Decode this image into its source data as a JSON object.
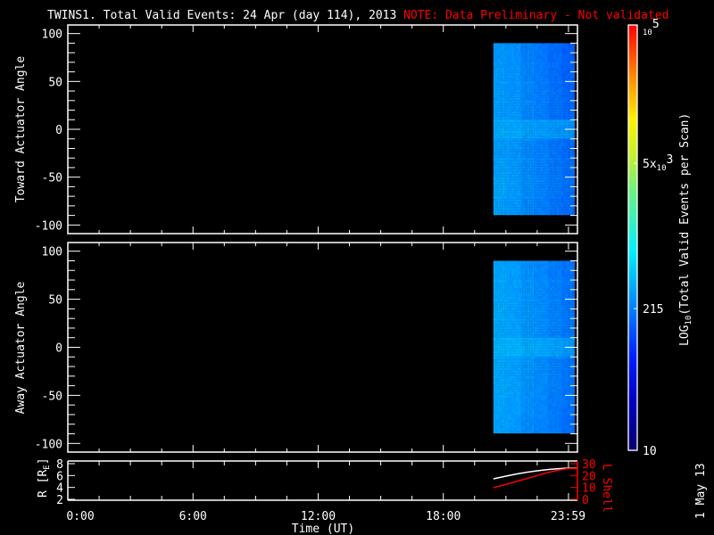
{
  "title": "TWINS1. Total Valid Events: 24 Apr (day 114), 2013",
  "note": "NOTE: Data Preliminary - Not validated",
  "date_stamp": "1 May 13",
  "colors": {
    "background": "#000000",
    "axes": "#ffffff",
    "note": "#ff0000",
    "r_line": "#ffffff",
    "l_line": "#ff0000"
  },
  "chart_data": [
    {
      "type": "heatmap",
      "name": "toward",
      "ylabel": "Toward Actuator Angle",
      "ylim": [
        -109,
        109
      ],
      "yticks": [
        "100",
        "50",
        "0",
        "-50",
        "-100"
      ],
      "ytick_values": [
        100,
        50,
        0,
        -50,
        -100
      ],
      "xlim_hours": [
        0,
        24.43
      ],
      "time_bins_hours": [
        20.4,
        21.05,
        21.7,
        22.35,
        23.0,
        23.65,
        24.25
      ],
      "angle_bins": [
        90,
        70,
        50,
        30,
        10,
        -10,
        -30,
        -50,
        -70,
        -89
      ],
      "values": [
        [
          290,
          260,
          230,
          200,
          180,
          160
        ],
        [
          300,
          270,
          240,
          210,
          185,
          165
        ],
        [
          300,
          275,
          245,
          215,
          190,
          170
        ],
        [
          305,
          280,
          250,
          220,
          195,
          175
        ],
        [
          360,
          340,
          320,
          300,
          290,
          280
        ],
        [
          310,
          285,
          255,
          225,
          200,
          180
        ],
        [
          320,
          290,
          260,
          230,
          205,
          185
        ],
        [
          340,
          300,
          265,
          235,
          210,
          190
        ],
        [
          310,
          285,
          255,
          225,
          200,
          180
        ]
      ]
    },
    {
      "type": "heatmap",
      "name": "away",
      "ylabel": "Away Actuator Angle",
      "ylim": [
        -109,
        109
      ],
      "yticks": [
        "100",
        "50",
        "0",
        "-50",
        "-100"
      ],
      "ytick_values": [
        100,
        50,
        0,
        -50,
        -100
      ],
      "xlim_hours": [
        0,
        24.43
      ],
      "time_bins_hours": [
        20.4,
        21.05,
        21.7,
        22.35,
        23.0,
        23.65,
        24.25
      ],
      "angle_bins": [
        90,
        70,
        50,
        30,
        10,
        -10,
        -30,
        -50,
        -70,
        -89
      ],
      "values": [
        [
          330,
          300,
          270,
          240,
          215,
          195
        ],
        [
          340,
          310,
          280,
          250,
          225,
          200
        ],
        [
          345,
          315,
          285,
          255,
          230,
          205
        ],
        [
          350,
          320,
          290,
          260,
          235,
          210
        ],
        [
          400,
          380,
          360,
          340,
          320,
          300
        ],
        [
          345,
          315,
          285,
          255,
          230,
          205
        ],
        [
          340,
          310,
          280,
          250,
          225,
          200
        ],
        [
          330,
          300,
          270,
          240,
          215,
          195
        ],
        [
          320,
          290,
          260,
          230,
          210,
          190
        ]
      ]
    },
    {
      "type": "line",
      "name": "orbit",
      "ylabel": "R [R",
      "ylabel_sub": "E",
      "ylabel_close": "]",
      "ylim": [
        2,
        8
      ],
      "yticks": [
        "8",
        "6",
        "4",
        "2"
      ],
      "ytick_values": [
        8,
        6,
        4,
        2
      ],
      "y2label": "L Shell",
      "y2lim": [
        0,
        30
      ],
      "y2ticks": [
        "30",
        "20",
        "10",
        "0"
      ],
      "y2tick_values": [
        30,
        20,
        10,
        0
      ],
      "xlabel": "Time (UT)",
      "xticks": [
        "0:00",
        "6:00",
        "12:00",
        "18:00",
        "23:59"
      ],
      "xtick_hours": [
        0,
        6,
        12,
        18,
        23.98
      ],
      "series": [
        {
          "name": "R",
          "axis": "left",
          "x": [
            20.4,
            21,
            21.5,
            22,
            22.5,
            23,
            23.5,
            24,
            24.43
          ],
          "y": [
            5.45,
            5.9,
            6.25,
            6.55,
            6.8,
            7.0,
            7.15,
            7.25,
            7.25
          ]
        },
        {
          "name": "L Shell",
          "axis": "right",
          "x": [
            20.4,
            21,
            21.5,
            22,
            22.5,
            23,
            23.5,
            24,
            24.43
          ],
          "y": [
            9.8,
            12.5,
            15,
            17.5,
            20,
            22.5,
            24.5,
            26,
            26
          ]
        }
      ]
    }
  ],
  "colorbar": {
    "label_main": "LOG",
    "label_sub": "10",
    "label_rest": "(Total Valid  Events  per Scan)",
    "scale": "log",
    "range": [
      10,
      100000
    ],
    "ticks": [
      {
        "value": 100000,
        "base": "10",
        "exp": "5",
        "prefix": ""
      },
      {
        "value": 5000,
        "base": "10",
        "exp": "3",
        "prefix": "5x"
      },
      {
        "value": 215,
        "base": "215",
        "exp": "",
        "prefix": ""
      },
      {
        "value": 10,
        "base": "10",
        "exp": "",
        "prefix": ""
      }
    ]
  }
}
